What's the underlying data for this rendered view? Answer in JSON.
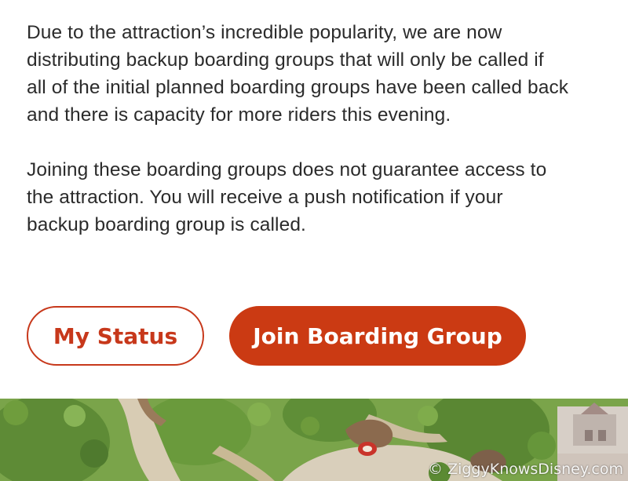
{
  "info": {
    "paragraph_1_lines": [
      "Due to the attraction’s incredible popularity, we are now",
      "distributing backup boarding groups that will only be called if",
      "all of the initial planned boarding groups have been called back",
      "and there is capacity for more riders this evening."
    ],
    "paragraph_2_lines": [
      "Joining these boarding groups does not guarantee access to",
      "the attraction. You will receive a push notification if your",
      "backup boarding group is called."
    ]
  },
  "actions": {
    "my_status_label": "My Status",
    "join_label": "Join Boarding Group"
  },
  "map": {
    "watermark": "© ZiggyKnowsDisney.com"
  },
  "colors": {
    "accent": "#cb3a13",
    "outline": "#c7381b",
    "text": "#2b2b2b"
  }
}
